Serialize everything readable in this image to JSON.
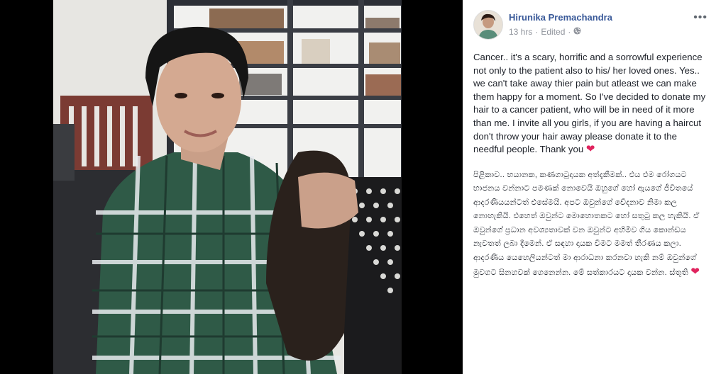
{
  "post": {
    "author": "Hirunika Premachandra",
    "timestamp": "13 hrs",
    "edited": "Edited",
    "separator": "·",
    "privacy_icon": "globe-icon",
    "more_icon": "more-options-icon",
    "text_en": "Cancer.. it's a scary, horrific and a sorrowful experience not only to the patient also to his/ her loved ones. Yes.. we can't take away thier pain but atleast we can make them happy for a moment. So I've decided to donate my hair to a cancer patient, who will be in need of it more than me. I invite all you girls, if you are having a haircut don't throw your hair away please donate it to the needful people. Thank you",
    "text_si": "පිළිකාව.. භයානක, කණගාටුදායක අත්දැකීමක්.. එය එම රෝගයට භාජනය වන්නාට පමණක් නොවෙයි ඔහුගේ හෝ ඇයගේ ජීවිතයේ ආදරණීයයන්ටත් එසේමයි. අපට ඔවුන්ගේ වේදනාව නිමා කල නොහැකියි. එහෙත් ඔවුන්ට මොහොතකට හෝ සතුටු කල හැකියි. ඒ ඔවුන්ගේ ප්‍රධාන අවශ්‍යතාවක් වන ඔවුන්ට අහිමිව ගිය කොන්ඩය නැවතත් ලබා දීමෙන්. ඒ සඳහා දායක වීමට මමත් තීරණය කලා. ආදරණීය යෙහෙලියන්ටත් මා ආරාධනා කරනවා හැකි නම් ඔවුන්ගේ මුවගට සිනහවක් ගෙනෙන්න. මේ සත්කාරයට දායක වන්න. ස්තූති",
    "heart": "❤",
    "accent": "#385898",
    "heart_color": "#e0245e"
  }
}
